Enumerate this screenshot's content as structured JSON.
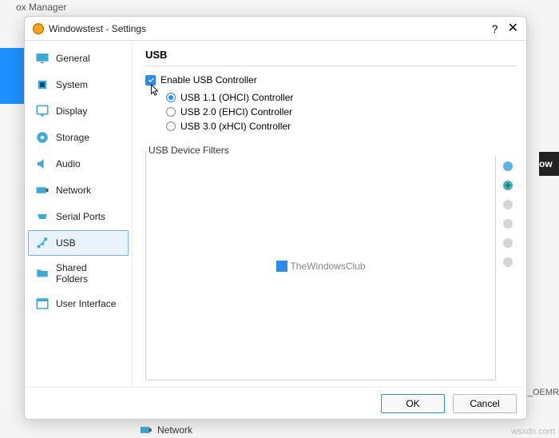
{
  "bg_title": "ox Manager",
  "bg_right_text": "ow",
  "bg_oemr": "_OEMR",
  "bg_network": "Network",
  "dialog_title": "Windowstest - Settings",
  "sidebar": {
    "items": [
      {
        "label": "General"
      },
      {
        "label": "System"
      },
      {
        "label": "Display"
      },
      {
        "label": "Storage"
      },
      {
        "label": "Audio"
      },
      {
        "label": "Network"
      },
      {
        "label": "Serial Ports"
      },
      {
        "label": "USB"
      },
      {
        "label": "Shared Folders"
      },
      {
        "label": "User Interface"
      }
    ]
  },
  "content": {
    "section_title": "USB",
    "enable_label": "Enable USB Controller",
    "radio1": "USB 1.1 (OHCI) Controller",
    "radio2": "USB 2.0 (EHCI) Controller",
    "radio3": "USB 3.0 (xHCI) Controller",
    "filters_label": "USB Device Filters",
    "watermark": "TheWindowsClub"
  },
  "footer": {
    "ok": "OK",
    "cancel": "Cancel"
  },
  "wsxdn": "wsxdn.com"
}
